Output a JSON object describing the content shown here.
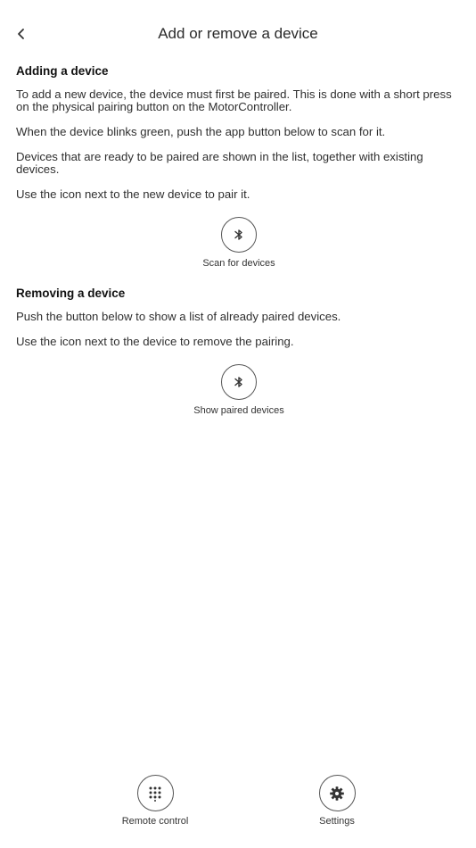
{
  "header": {
    "back_icon": "chevron-left-icon",
    "title": "Add or remove a device"
  },
  "adding": {
    "heading": "Adding a device",
    "paragraphs": [
      "To add a new device, the device must first be paired. This is done with a short press on the physical pairing button on the MotorController.",
      "When the device blinks green, push the app button below to scan for it.",
      "Devices that are ready to be paired are shown in the list, together with existing devices.",
      "Use the icon next to the new device to pair it."
    ],
    "button_icon": "bluetooth-icon",
    "button_label": "Scan for devices"
  },
  "removing": {
    "heading": "Removing a device",
    "paragraphs": [
      "Push the button below to show a list of already paired devices.",
      "Use the icon next to the device to remove the pairing."
    ],
    "button_icon": "bluetooth-icon",
    "button_label": "Show paired devices"
  },
  "bottom_nav": {
    "items": [
      {
        "label": "Remote control",
        "icon": "keypad-icon"
      },
      {
        "label": "Settings",
        "icon": "gear-icon"
      }
    ]
  }
}
